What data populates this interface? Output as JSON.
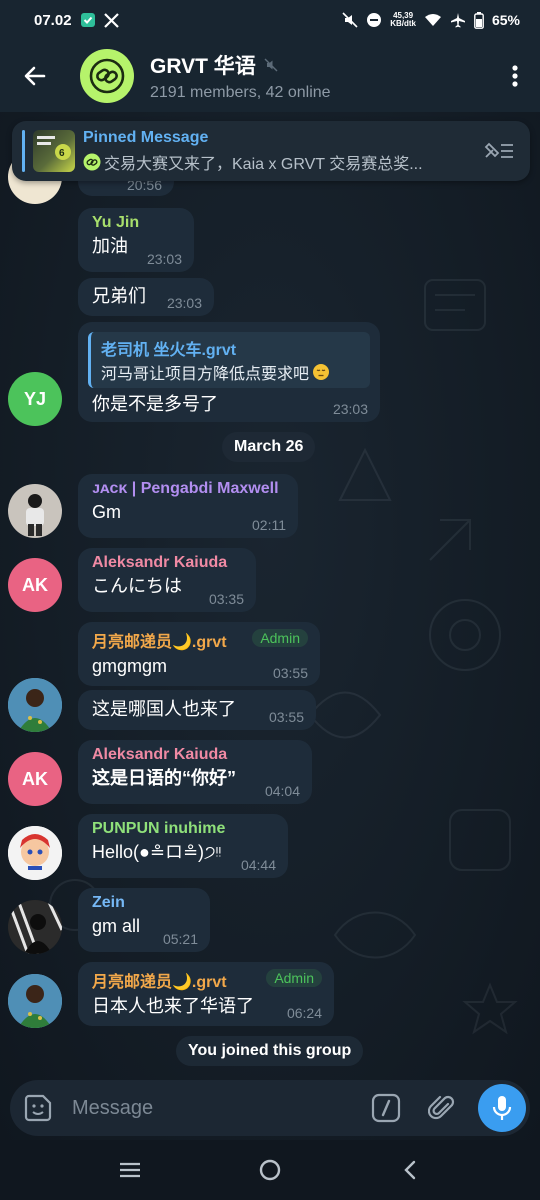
{
  "status_bar": {
    "time": "07.02",
    "net_speed_value": "45,39",
    "net_speed_unit": "KB/dtk",
    "battery": "65%",
    "icons": [
      "shield-check-icon",
      "x-logo-icon",
      "mute-icon",
      "dnd-icon",
      "wifi-icon",
      "airplane-icon",
      "battery-icon"
    ]
  },
  "header": {
    "title": "GRVT 华语",
    "subtitle": "2191 members, 42 online",
    "avatar_color": "#b6f36b"
  },
  "pinned": {
    "label": "Pinned Message",
    "preview": "交易大赛又来了，Kaia x GRVT 交易赛总奖..."
  },
  "messages": [
    {
      "time": "20:56"
    },
    {
      "sender": "Yu Jin",
      "text": "加油",
      "time": "23:03"
    },
    {
      "text": "兄弟们",
      "time": "23:03"
    },
    {
      "reply_name": "老司机 坐火车.grvt",
      "reply_text": "河马哥让项目方降低点要求吧",
      "text": "你是不是多号了",
      "time": "23:03",
      "avatar_initials": "YJ"
    },
    {
      "sender": "ᴊᴀᴄᴋ | Pengabdi Maxwell",
      "text": "Gm",
      "time": "02:11"
    },
    {
      "sender": "Aleksandr Kaiuda",
      "text": "こんにちは",
      "time": "03:35",
      "avatar_initials": "AK"
    },
    {
      "sender": "月亮邮递员🌙.grvt",
      "badge": "Admin",
      "text": "gmgmgm",
      "time": "03:55"
    },
    {
      "text": "这是哪国人也来了",
      "time": "03:55"
    },
    {
      "sender": "Aleksandr Kaiuda",
      "text": "这是日语的“你好”",
      "time": "04:04",
      "avatar_initials": "AK"
    },
    {
      "sender": "PUNPUN inuhime",
      "text": "Hello(●≗ロ≗)੭ᵎᵎ",
      "time": "04:44"
    },
    {
      "sender": "Zein",
      "text": "gm all",
      "time": "05:21"
    },
    {
      "sender": "月亮邮递员🌙.grvt",
      "badge": "Admin",
      "text": "日本人也来了华语了",
      "time": "06:24"
    }
  ],
  "date_separator": "March 26",
  "service_message": "You joined this group",
  "input": {
    "placeholder": "Message"
  },
  "colors": {
    "name_green": "#a8df6c",
    "name_purple": "#b28ef0",
    "name_pink": "#f08aa4",
    "name_orange": "#f2a84a",
    "name_lime": "#8fe07a",
    "name_blue": "#76b8f5",
    "avatar_green": "#4cc35b",
    "avatar_pink": "#e96383",
    "accent": "#3a9df0"
  }
}
